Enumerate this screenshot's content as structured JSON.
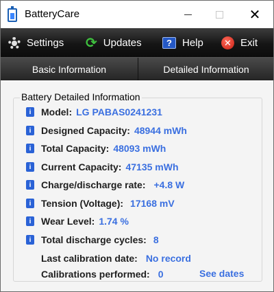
{
  "window": {
    "title": "BatteryCare",
    "close_glyph": "✕"
  },
  "toolbar": [
    {
      "name": "settings",
      "label": "Settings",
      "icon": "gear-icon"
    },
    {
      "name": "updates",
      "label": "Updates",
      "icon": "refresh-icon"
    },
    {
      "name": "help",
      "label": "Help",
      "icon": "help-book-icon",
      "glyph": "?"
    },
    {
      "name": "exit",
      "label": "Exit",
      "icon": "exit-x-icon",
      "glyph": "✕"
    }
  ],
  "tabs": {
    "basic": "Basic Information",
    "detailed": "Detailed Information"
  },
  "details": {
    "group_title": "Battery Detailed Information",
    "info_glyph": "i",
    "model": {
      "label": "Model:",
      "value": "LG  PABAS0241231"
    },
    "designed_capacity": {
      "label": "Designed Capacity:",
      "value": "48944 mWh"
    },
    "total_capacity": {
      "label": "Total Capacity:",
      "value": "48093 mWh"
    },
    "current_capacity": {
      "label": "Current Capacity:",
      "value": "47135 mWh"
    },
    "rate": {
      "label": "Charge/discharge rate:",
      "value": "+4.8 W"
    },
    "tension": {
      "label": "Tension (Voltage):",
      "value": "17168 mV"
    },
    "wear": {
      "label": "Wear Level:",
      "value": "1.74 %"
    },
    "cycles": {
      "label": "Total discharge cycles:",
      "value": "8"
    },
    "last_calibration": {
      "label": "Last calibration date:",
      "value": "No record"
    },
    "calibrations": {
      "label": "Calibrations performed:",
      "value": "0"
    },
    "see_dates": "See dates"
  },
  "colors": {
    "accent_value": "#3a6fe0",
    "info_icon": "#2a62d6",
    "toolbar_bg": "#151515"
  }
}
